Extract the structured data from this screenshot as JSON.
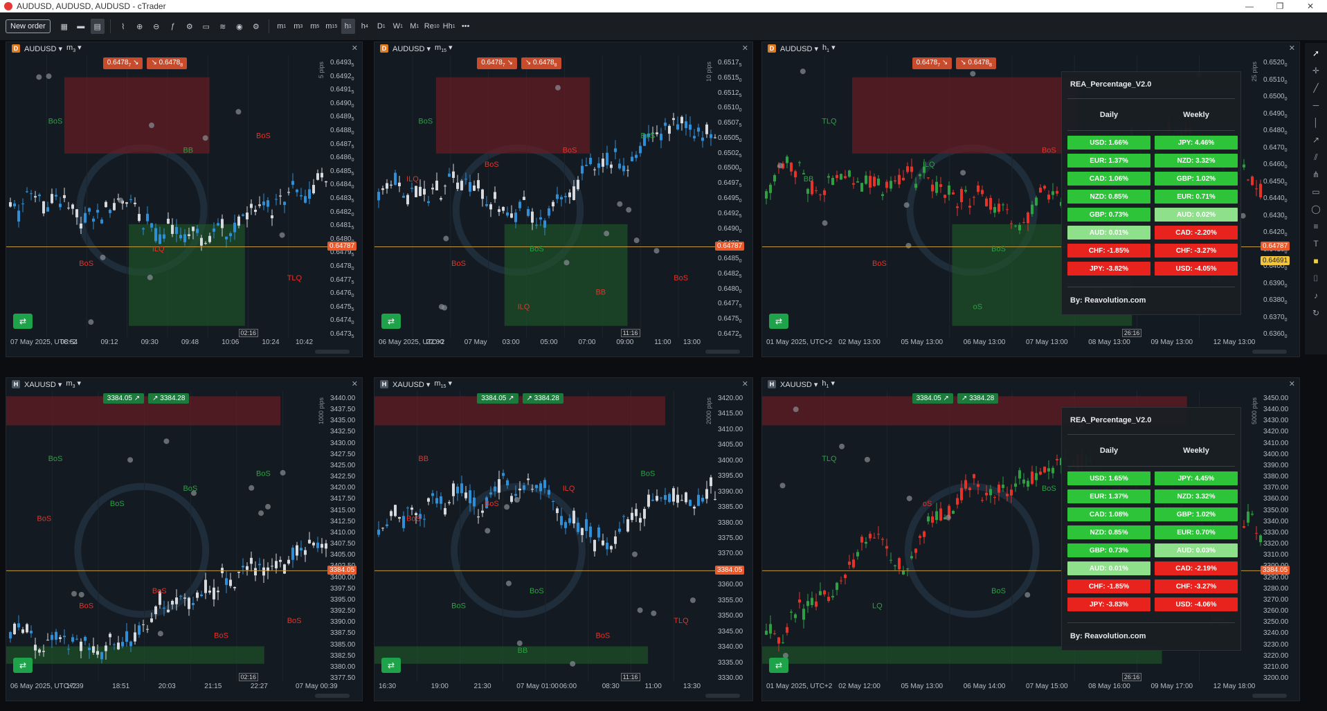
{
  "window": {
    "title": "AUDUSD, AUDUSD, AUDUSD - cTrader",
    "minimize": "—",
    "restore": "❐",
    "close": "✕"
  },
  "toolbar": {
    "new_order": "New order",
    "timeframes": [
      {
        "label": "m",
        "sub": "1"
      },
      {
        "label": "m",
        "sub": "3"
      },
      {
        "label": "m",
        "sub": "5"
      },
      {
        "label": "m",
        "sub": "15"
      },
      {
        "label": "h",
        "sub": "1"
      },
      {
        "label": "h",
        "sub": "4"
      },
      {
        "label": "D",
        "sub": "1"
      },
      {
        "label": "W",
        "sub": "1"
      },
      {
        "label": "M",
        "sub": "1"
      },
      {
        "label": "Re",
        "sub": "10"
      },
      {
        "label": "Hh",
        "sub": "1"
      }
    ],
    "more": "•••"
  },
  "colors": {
    "bull": "#2f8fd6",
    "bear": "#d6d9dd",
    "bos_green": "#2ea043",
    "bos_red": "#e5332a",
    "zone_red": "#6a1d24",
    "zone_green": "#1f5a2a",
    "price_line": "#c49a3a"
  },
  "charts": [
    {
      "id": "c1",
      "badge": "D",
      "badge_color": "#e07a1f",
      "symbol": "AUDUSD",
      "tf": "m",
      "tf_sub": "3",
      "sell": "0.6478",
      "sell_sub": "7",
      "buy": "0.6478",
      "buy_sub": "8",
      "price_ticks": [
        "0.6493",
        "0.6492",
        "0.6491",
        "0.6490",
        "0.6489",
        "0.6488",
        "0.6487",
        "0.6486",
        "0.6485",
        "0.6484",
        "0.6483",
        "0.6482",
        "0.6481",
        "0.6480",
        "0.6479",
        "0.6478",
        "0.6477",
        "0.6476",
        "0.6475",
        "0.6474",
        "0.6473"
      ],
      "price_subs": [
        "5",
        "0",
        "5",
        "0",
        "5",
        "0",
        "5",
        "0",
        "5",
        "0",
        "5",
        "0",
        "5",
        "0",
        "5",
        "0",
        "5",
        "0",
        "5",
        "0",
        "5"
      ],
      "last_price": "0.64787",
      "time_ticks": [
        "07 May 2025, UTC+2",
        "08:54",
        "09:12",
        "09:30",
        "09:48",
        "10:06",
        "10:24",
        "10:42"
      ],
      "countdown": "02:16",
      "pips": "5 pips",
      "labels": [
        {
          "t": "BoS",
          "c": "g"
        },
        {
          "t": "ILQ",
          "c": "r"
        },
        {
          "t": "BoS",
          "c": "r"
        },
        {
          "t": "BoS",
          "c": "r"
        },
        {
          "t": "BB",
          "c": "g"
        },
        {
          "t": "TLQ",
          "c": "r"
        }
      ]
    },
    {
      "id": "c2",
      "badge": "D",
      "badge_color": "#e07a1f",
      "symbol": "AUDUSD",
      "tf": "m",
      "tf_sub": "15",
      "sell": "0.6478",
      "sell_sub": "7",
      "buy": "0.6478",
      "buy_sub": "8",
      "price_ticks": [
        "0.6517",
        "0.6515",
        "0.6512",
        "0.6510",
        "0.6507",
        "0.6505",
        "0.6502",
        "0.6500",
        "0.6497",
        "0.6495",
        "0.6492",
        "0.6490",
        "0.6487",
        "0.6485",
        "0.6482",
        "0.6480",
        "0.6477",
        "0.6475",
        "0.6472"
      ],
      "price_subs": [
        "5",
        "0",
        "5",
        "0",
        "5",
        "0",
        "5",
        "0",
        "5",
        "0",
        "5",
        "0",
        "5",
        "0",
        "5",
        "0",
        "5",
        "0",
        "5"
      ],
      "last_price": "0.64787",
      "time_ticks": [
        "06 May 2025, UTC+2",
        "22:00",
        "07 May",
        "03:00",
        "05:00",
        "07:00",
        "09:00",
        "11:00",
        "13:00"
      ],
      "countdown": "11:16",
      "pips": "10 pips",
      "labels": [
        {
          "t": "BoS",
          "c": "g"
        },
        {
          "t": "BoS",
          "c": "g"
        },
        {
          "t": "BoS",
          "c": "g"
        },
        {
          "t": "BoS",
          "c": "r"
        },
        {
          "t": "BoS",
          "c": "r"
        },
        {
          "t": "BoS",
          "c": "r"
        },
        {
          "t": "BoS",
          "c": "r"
        },
        {
          "t": "BB",
          "c": "r"
        },
        {
          "t": "ILQ",
          "c": "r"
        },
        {
          "t": "ILQ",
          "c": "r"
        }
      ]
    },
    {
      "id": "c3",
      "badge": "D",
      "badge_color": "#e07a1f",
      "symbol": "AUDUSD",
      "tf": "h",
      "tf_sub": "1",
      "sell": "0.6478",
      "sell_sub": "7",
      "buy": "0.6478",
      "buy_sub": "8",
      "price_ticks": [
        "0.6520",
        "0.6510",
        "0.6500",
        "0.6490",
        "0.6480",
        "0.6470",
        "0.6460",
        "0.6450",
        "0.6440",
        "0.6430",
        "0.6420",
        "0.6410",
        "0.6400",
        "0.6390",
        "0.6380",
        "0.6370",
        "0.6360"
      ],
      "price_subs": [
        "0",
        "0",
        "0",
        "0",
        "0",
        "0",
        "0",
        "0",
        "0",
        "0",
        "0",
        "0",
        "0",
        "0",
        "0",
        "0",
        "0"
      ],
      "last_price": "0.64787",
      "second_price": "0.64691",
      "time_ticks": [
        "01 May 2025, UTC+2",
        "02 May 13:00",
        "05 May 13:00",
        "06 May 13:00",
        "07 May 13:00",
        "08 May 13:00",
        "09 May 13:00",
        "12 May 13:00"
      ],
      "countdown": "26:16",
      "pips": "25 pips",
      "labels": [
        {
          "t": "TLQ",
          "c": "g"
        },
        {
          "t": "BoS",
          "c": "g"
        },
        {
          "t": "BoS",
          "c": "g"
        },
        {
          "t": "BoS",
          "c": "r"
        },
        {
          "t": "BoS",
          "c": "r"
        },
        {
          "t": "BB",
          "c": "g"
        },
        {
          "t": "ILQ",
          "c": "g"
        },
        {
          "t": "BB",
          "c": "g"
        },
        {
          "t": "BB",
          "c": "g"
        },
        {
          "t": "oS",
          "c": "g"
        }
      ],
      "panel": {
        "title": "REA_Percentage_V2.0",
        "daily": "Daily",
        "weekly": "Weekly",
        "daily_rows": [
          {
            "t": "USD: 1.66%",
            "k": "g"
          },
          {
            "t": "EUR: 1.37%",
            "k": "g"
          },
          {
            "t": "CAD: 1.06%",
            "k": "g"
          },
          {
            "t": "NZD: 0.85%",
            "k": "g"
          },
          {
            "t": "GBP: 0.73%",
            "k": "g"
          },
          {
            "t": "AUD: 0.01%",
            "k": "lg"
          },
          {
            "t": "CHF: -1.85%",
            "k": "r"
          },
          {
            "t": "JPY: -3.82%",
            "k": "r"
          }
        ],
        "weekly_rows": [
          {
            "t": "JPY: 4.46%",
            "k": "g"
          },
          {
            "t": "NZD: 3.32%",
            "k": "g"
          },
          {
            "t": "GBP: 1.02%",
            "k": "g"
          },
          {
            "t": "EUR: 0.71%",
            "k": "g"
          },
          {
            "t": "AUD: 0.02%",
            "k": "lg"
          },
          {
            "t": "CAD: -2.20%",
            "k": "r"
          },
          {
            "t": "CHF: -3.27%",
            "k": "r"
          },
          {
            "t": "USD: -4.05%",
            "k": "r"
          }
        ],
        "by": "By: Reavolution.com"
      }
    },
    {
      "id": "c4",
      "badge": "H",
      "badge_color": "#4a5560",
      "symbol": "XAUUSD",
      "tf": "m",
      "tf_sub": "3",
      "sell": "3384.05",
      "buy": "3384.28",
      "price_ticks": [
        "3440.00",
        "3437.50",
        "3435.00",
        "3432.50",
        "3430.00",
        "3427.50",
        "3425.00",
        "3422.50",
        "3420.00",
        "3417.50",
        "3415.00",
        "3412.50",
        "3410.00",
        "3407.50",
        "3405.00",
        "3402.50",
        "3400.00",
        "3397.50",
        "3395.00",
        "3392.50",
        "3390.00",
        "3387.50",
        "3385.00",
        "3382.50",
        "3380.00",
        "3377.50"
      ],
      "last_price": "3384.05",
      "time_ticks": [
        "06 May 2025, UTC+2",
        "17:39",
        "18:51",
        "20:03",
        "21:15",
        "22:27",
        "07 May 00:39"
      ],
      "countdown": "02:16",
      "pips": "1000 pips",
      "labels": [
        {
          "t": "BoS",
          "c": "g"
        },
        {
          "t": "BoS",
          "c": "r"
        },
        {
          "t": "BoS",
          "c": "g"
        },
        {
          "t": "BoS",
          "c": "r"
        },
        {
          "t": "BoS",
          "c": "g"
        },
        {
          "t": "BoS",
          "c": "r"
        },
        {
          "t": "BoS",
          "c": "g"
        },
        {
          "t": "BoS",
          "c": "r"
        },
        {
          "t": "BoS",
          "c": "r"
        }
      ]
    },
    {
      "id": "c5",
      "badge": "H",
      "badge_color": "#4a5560",
      "symbol": "XAUUSD",
      "tf": "m",
      "tf_sub": "15",
      "sell": "3384.05",
      "buy": "3384.28",
      "price_ticks": [
        "3420.00",
        "3415.00",
        "3410.00",
        "3405.00",
        "3400.00",
        "3395.00",
        "3390.00",
        "3385.00",
        "3380.00",
        "3375.00",
        "3370.00",
        "3365.00",
        "3360.00",
        "3355.00",
        "3350.00",
        "3345.00",
        "3340.00",
        "3335.00",
        "3330.00"
      ],
      "last_price": "3384.05",
      "time_ticks": [
        "16:30",
        "19:00",
        "21:30",
        "07 May 01:00",
        "06:00",
        "08:30",
        "11:00",
        "13:30"
      ],
      "countdown": "11:16",
      "pips": "2000 pips",
      "labels": [
        {
          "t": "BB",
          "c": "r"
        },
        {
          "t": "BoS",
          "c": "g"
        },
        {
          "t": "BoS",
          "c": "g"
        },
        {
          "t": "BoS",
          "c": "g"
        },
        {
          "t": "ILQ",
          "c": "r"
        },
        {
          "t": "TLQ",
          "c": "r"
        },
        {
          "t": "BoS",
          "c": "r"
        },
        {
          "t": "BoS",
          "c": "r"
        },
        {
          "t": "BoS",
          "c": "r"
        },
        {
          "t": "BB",
          "c": "g"
        }
      ]
    },
    {
      "id": "c6",
      "badge": "H",
      "badge_color": "#4a5560",
      "symbol": "XAUUSD",
      "tf": "h",
      "tf_sub": "1",
      "sell": "3384.05",
      "buy": "3384.28",
      "price_ticks": [
        "3450.00",
        "3440.00",
        "3430.00",
        "3420.00",
        "3410.00",
        "3400.00",
        "3390.00",
        "3380.00",
        "3370.00",
        "3360.00",
        "3350.00",
        "3340.00",
        "3330.00",
        "3320.00",
        "3310.00",
        "3300.00",
        "3290.00",
        "3280.00",
        "3270.00",
        "3260.00",
        "3250.00",
        "3240.00",
        "3230.00",
        "3220.00",
        "3210.00",
        "3200.00"
      ],
      "last_price": "3384.05",
      "time_ticks": [
        "01 May 2025, UTC+2",
        "02 May 12:00",
        "05 May 13:00",
        "06 May 14:00",
        "07 May 15:00",
        "08 May 16:00",
        "09 May 17:00",
        "12 May 18:00"
      ],
      "countdown": "26:16",
      "pips": "5000 pips",
      "labels": [
        {
          "t": "TLQ",
          "c": "g"
        },
        {
          "t": "BoS",
          "c": "g"
        },
        {
          "t": "BB",
          "c": "g"
        },
        {
          "t": "LQ",
          "c": "g"
        },
        {
          "t": "BoS",
          "c": "g"
        },
        {
          "t": "BoS",
          "c": "g"
        },
        {
          "t": "oS",
          "c": "r"
        }
      ],
      "panel": {
        "title": "REA_Percentage_V2.0",
        "daily": "Daily",
        "weekly": "Weekly",
        "daily_rows": [
          {
            "t": "USD: 1.65%",
            "k": "g"
          },
          {
            "t": "EUR: 1.37%",
            "k": "g"
          },
          {
            "t": "CAD: 1.08%",
            "k": "g"
          },
          {
            "t": "NZD: 0.85%",
            "k": "g"
          },
          {
            "t": "GBP: 0.73%",
            "k": "g"
          },
          {
            "t": "AUD: 0.01%",
            "k": "lg"
          },
          {
            "t": "CHF: -1.85%",
            "k": "r"
          },
          {
            "t": "JPY: -3.83%",
            "k": "r"
          }
        ],
        "weekly_rows": [
          {
            "t": "JPY: 4.45%",
            "k": "g"
          },
          {
            "t": "NZD: 3.32%",
            "k": "g"
          },
          {
            "t": "GBP: 1.02%",
            "k": "g"
          },
          {
            "t": "EUR: 0.70%",
            "k": "g"
          },
          {
            "t": "AUD: 0.03%",
            "k": "lg"
          },
          {
            "t": "CAD: -2.19%",
            "k": "r"
          },
          {
            "t": "CHF: -3.27%",
            "k": "r"
          },
          {
            "t": "USD: -4.06%",
            "k": "r"
          }
        ],
        "by": "By: Reavolution.com"
      }
    }
  ]
}
